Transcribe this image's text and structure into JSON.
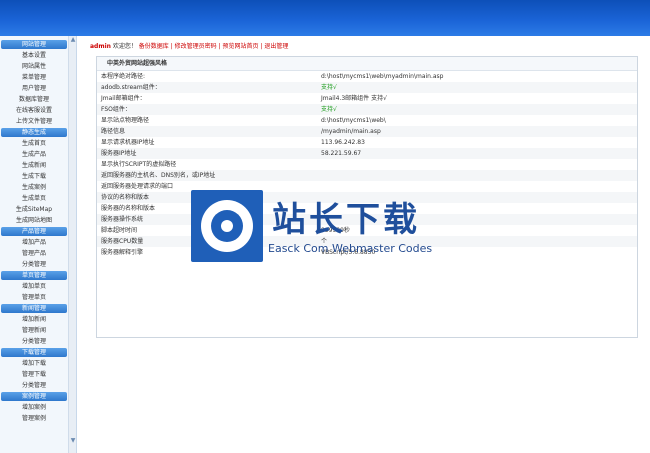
{
  "welcome": {
    "user": "admin",
    "greeting": "欢迎您！",
    "links": [
      "备份数据库",
      "修改管理员密码",
      "预览网站首页",
      "退出管理"
    ]
  },
  "sidebar": [
    {
      "group": "网站管理",
      "items": [
        "基本设置",
        "网站属性",
        "菜单管理",
        "用户管理",
        "数据库管理",
        "在线客服设置",
        "上传文件管理"
      ]
    },
    {
      "group": "静态生成",
      "items": [
        "生成首页",
        "生成产品",
        "生成新闻",
        "生成下载",
        "生成案例",
        "生成单页",
        "生成SiteMap",
        "生成网站地图"
      ]
    },
    {
      "group": "产品管理",
      "items": [
        "增加产品",
        "管理产品",
        "分类管理"
      ]
    },
    {
      "group": "单页管理",
      "items": [
        "增加单页",
        "管理单页"
      ]
    },
    {
      "group": "新闻管理",
      "items": [
        "增加新闻",
        "管理新闻",
        "分类管理"
      ]
    },
    {
      "group": "下载管理",
      "items": [
        "增加下载",
        "管理下载",
        "分类管理"
      ]
    },
    {
      "group": "案例管理",
      "items": [
        "增加案例",
        "管理案例"
      ]
    }
  ],
  "panel": {
    "title": "中英外贸网站超强风格",
    "rows": [
      [
        "本程序绝对路径:",
        "d:\\host\\mycms1\\web\\myadmin\\main.asp",
        false
      ],
      [
        "adodb.stream组件：",
        "支持√",
        true
      ],
      [
        "Jmail邮箱组件：",
        "Jmail4.3邮箱组件 支持√",
        false
      ],
      [
        "FSO组件：",
        "支持√",
        true
      ],
      [
        "显示站点物理路径",
        "d:\\host\\mycms1\\web\\",
        false
      ],
      [
        "路径信息",
        "/myadmin/main.asp",
        false
      ],
      [
        "显示请求机器IP地址",
        "113.96.242.83",
        false
      ],
      [
        "服务器IP地址",
        "58.221.59.67",
        false
      ],
      [
        "显示执行SCRIPT的虚拟路径",
        "",
        false
      ],
      [
        "返回服务器的主机名、DNS别名，或IP地址",
        "",
        false
      ],
      [
        "返回服务器处理请求的端口",
        "",
        false
      ],
      [
        "协议的名称和版本",
        "",
        false
      ],
      [
        "服务器的名称和版本",
        "",
        false
      ],
      [
        "服务器操作系统",
        "",
        false
      ],
      [
        "脚本超时时间",
        "999999秒",
        false
      ],
      [
        "服务器CPU数量",
        "个",
        false
      ],
      [
        "服务器解释引擎",
        "VBScript/5.6.8830",
        false
      ]
    ]
  },
  "watermark": {
    "title": "站长下载",
    "subtitle": "Easck Com Webmaster Codes"
  }
}
